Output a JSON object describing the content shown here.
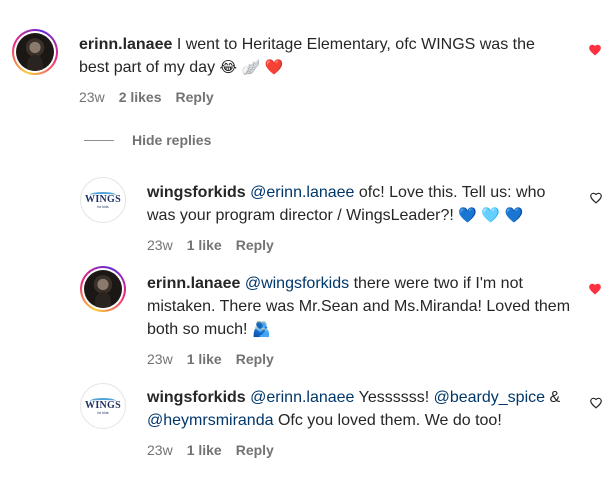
{
  "comments": [
    {
      "username": "erinn.lanaee",
      "text": "I went to Heritage Elementary, ofc WINGS was the best part of my day",
      "emojis": [
        "😂",
        "🪽",
        "❤️"
      ],
      "time": "23w",
      "likes": "2 likes",
      "reply": "Reply",
      "liked": true
    },
    {
      "username": "wingsforkids",
      "mention": "@erinn.lanaee",
      "text": "ofc! Love this. Tell us: who was your program director / WingsLeader?!",
      "emojis": [
        "💙",
        "🩵",
        "💙"
      ],
      "time": "23w",
      "likes": "1 like",
      "reply": "Reply",
      "liked": false,
      "avatar_text": "WINGS",
      "avatar_subtext": "for kids"
    },
    {
      "username": "erinn.lanaee",
      "mention": "@wingsforkids",
      "text": "there were two if I'm not mistaken. There was Mr.Sean and Ms.Miranda! Loved them both so much!",
      "emojis": [
        "🫂"
      ],
      "time": "23w",
      "likes": "1 like",
      "reply": "Reply",
      "liked": true
    },
    {
      "username": "wingsforkids",
      "mention": "@erinn.lanaee",
      "text_a": "Yessssss!",
      "mention_b": "@beardy_spice",
      "text_b": "&",
      "mention_c": "@heymrsmiranda",
      "text_c": "Ofc you loved them. We do too!",
      "time": "23w",
      "likes": "1 like",
      "reply": "Reply",
      "liked": false,
      "avatar_text": "WINGS",
      "avatar_subtext": "for kids"
    }
  ],
  "hide_replies": "Hide replies",
  "colors": {
    "heart_red": "#ff3040",
    "mention": "#00376b",
    "meta_gray": "#737373"
  },
  "icons": [
    "heart-filled-icon",
    "heart-outline-icon"
  ]
}
